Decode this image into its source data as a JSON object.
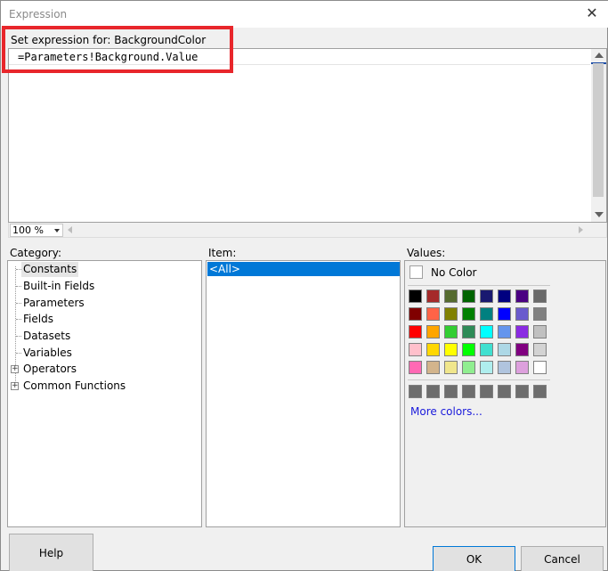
{
  "dialog": {
    "title": "Expression",
    "close_glyph": "✕"
  },
  "editor": {
    "label": "Set expression for: BackgroundColor",
    "expression": "=Parameters!Background.Value",
    "zoom": "100 %"
  },
  "category": {
    "label": "Category:",
    "items": [
      "Constants",
      "Built-in Fields",
      "Parameters",
      "Fields",
      "Datasets",
      "Variables",
      "Operators",
      "Common Functions"
    ],
    "expand_glyph": "+"
  },
  "item": {
    "label": "Item:",
    "selected": "<All>"
  },
  "values": {
    "label": "Values:",
    "no_color": "No Color",
    "more_colors": "More colors...",
    "swatches": [
      [
        "#000000",
        "#a52a2a",
        "#556b2f",
        "#006400",
        "#191970",
        "#000080",
        "#4b0082",
        "#696969"
      ],
      [
        "#800000",
        "#ff6347",
        "#808000",
        "#008000",
        "#008080",
        "#0000ff",
        "#6a5acd",
        "#808080"
      ],
      [
        "#ff0000",
        "#ffa500",
        "#32cd32",
        "#2e8b57",
        "#00ffff",
        "#6495ed",
        "#8a2be2",
        "#c0c0c0"
      ],
      [
        "#ffc0cb",
        "#ffd700",
        "#ffff00",
        "#00ff00",
        "#40e0d0",
        "#add8e6",
        "#800080",
        "#d3d3d3"
      ],
      [
        "#ff69b4",
        "#d2b48c",
        "#f0e68c",
        "#90ee90",
        "#afeeee",
        "#b0c4de",
        "#dda0dd",
        "#ffffff"
      ]
    ],
    "custom_swatches": [
      "#6d6d6d",
      "#6d6d6d",
      "#6d6d6d",
      "#6d6d6d",
      "#6d6d6d",
      "#6d6d6d",
      "#6d6d6d",
      "#6d6d6d"
    ]
  },
  "buttons": {
    "help": "Help",
    "ok": "OK",
    "cancel": "Cancel"
  },
  "colors": {
    "highlight": "#e8262b",
    "selection": "#0078d7",
    "link": "#1a1adb"
  }
}
